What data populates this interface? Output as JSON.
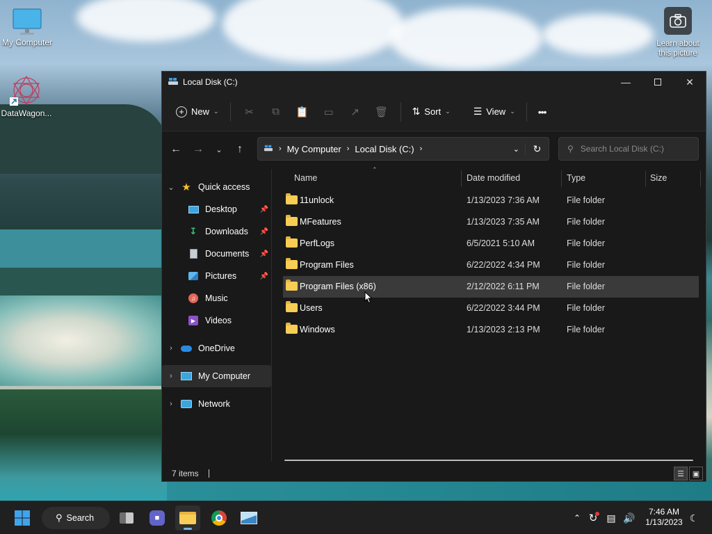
{
  "desktop": {
    "icons": [
      {
        "label": "My Computer",
        "icon": "monitor-icon"
      },
      {
        "label": "DataWagon...",
        "icon": "app-shortcut-icon"
      }
    ],
    "learn_picture": "Learn about this picture"
  },
  "window": {
    "title": "Local Disk (C:)",
    "toolbar": {
      "new_label": "New",
      "sort_label": "Sort",
      "view_label": "View",
      "more_label": "•••"
    },
    "address": {
      "crumbs": [
        "My Computer",
        "Local Disk (C:)"
      ]
    },
    "search": {
      "placeholder": "Search Local Disk (C:)"
    },
    "sidebar": {
      "quick_access": "Quick access",
      "quick_items": [
        {
          "label": "Desktop",
          "icon": "desktop-folder-icon",
          "pinned": true
        },
        {
          "label": "Downloads",
          "icon": "download-icon",
          "pinned": true
        },
        {
          "label": "Documents",
          "icon": "documents-icon",
          "pinned": true
        },
        {
          "label": "Pictures",
          "icon": "pictures-icon",
          "pinned": true
        },
        {
          "label": "Music",
          "icon": "music-icon",
          "pinned": false
        },
        {
          "label": "Videos",
          "icon": "videos-icon",
          "pinned": false
        }
      ],
      "onedrive": "OneDrive",
      "my_computer": "My Computer",
      "network": "Network"
    },
    "columns": {
      "name": "Name",
      "date": "Date modified",
      "type": "Type",
      "size": "Size"
    },
    "files": [
      {
        "name": "11unlock",
        "date": "1/13/2023 7:36 AM",
        "type": "File folder"
      },
      {
        "name": "MFeatures",
        "date": "1/13/2023 7:35 AM",
        "type": "File folder"
      },
      {
        "name": "PerfLogs",
        "date": "6/5/2021 5:10 AM",
        "type": "File folder"
      },
      {
        "name": "Program Files",
        "date": "6/22/2022 4:34 PM",
        "type": "File folder"
      },
      {
        "name": "Program Files (x86)",
        "date": "2/12/2022 6:11 PM",
        "type": "File folder"
      },
      {
        "name": "Users",
        "date": "6/22/2022 3:44 PM",
        "type": "File folder"
      },
      {
        "name": "Windows",
        "date": "1/13/2023 2:13 PM",
        "type": "File folder"
      }
    ],
    "status": "7 items"
  },
  "taskbar": {
    "search_label": "Search",
    "time": "7:46 AM",
    "date": "1/13/2023"
  }
}
